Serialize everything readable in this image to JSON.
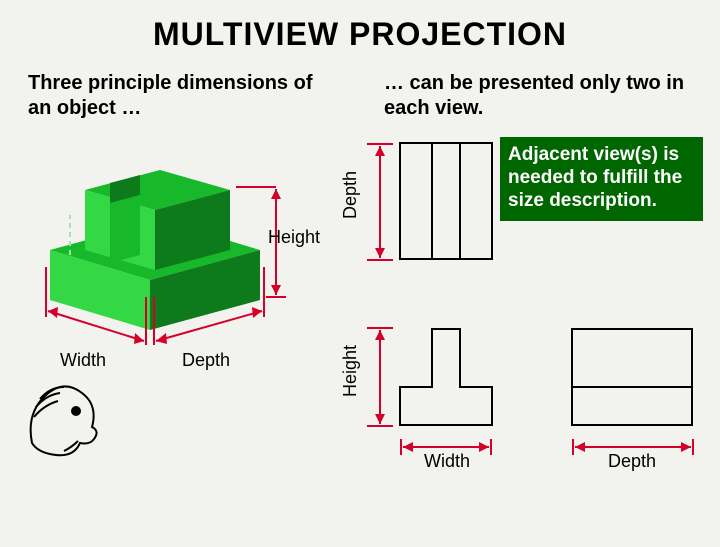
{
  "title": "MULTIVIEW   PROJECTION",
  "subhead_left": "Three principle dimensions of an object …",
  "subhead_right": "… can be presented only two in each view.",
  "callout": "Adjacent view(s) is needed to fulfill the size description.",
  "labels": {
    "height": "Height",
    "width": "Width",
    "depth": "Depth"
  },
  "colors": {
    "iso_light": "#34d844",
    "iso_mid": "#18b82b",
    "iso_dark": "#0d7a1c",
    "dim": "#d4002a",
    "callout_bg": "#006600"
  }
}
